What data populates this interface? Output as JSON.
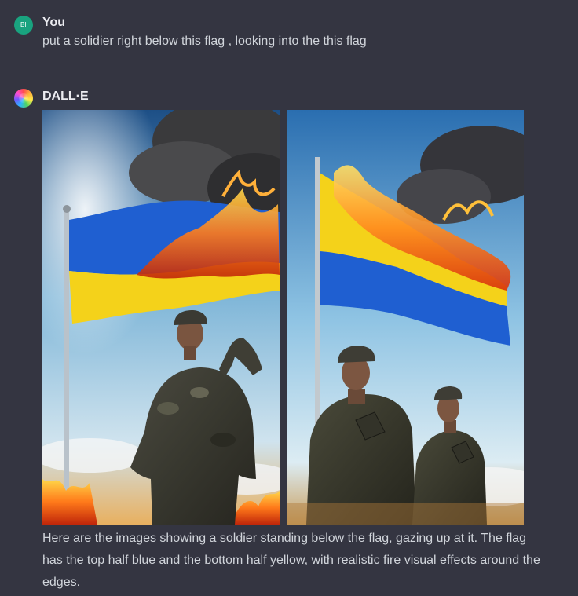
{
  "conversation": {
    "user_message": {
      "avatar_initials": "BI",
      "author": "You",
      "text": "put a solidier right below this flag , looking into the this flag"
    },
    "assistant_message": {
      "author": "DALL·E",
      "images": [
        {
          "name": "generated-image-1",
          "description_icon": "soldier-saluting-burning-flag-image"
        },
        {
          "name": "generated-image-2",
          "description_icon": "two-soldiers-burning-flag-image"
        }
      ],
      "text": "Here are the images showing a soldier standing below the flag, gazing up at it. The flag has the top half blue and the bottom half yellow, with realistic fire visual effects around the edges."
    }
  },
  "colors": {
    "background": "#343541",
    "user_avatar": "#19a37f",
    "flag_blue": "#1f5fd1",
    "flag_yellow": "#f4d21a",
    "fire": "#ff7a1a"
  }
}
